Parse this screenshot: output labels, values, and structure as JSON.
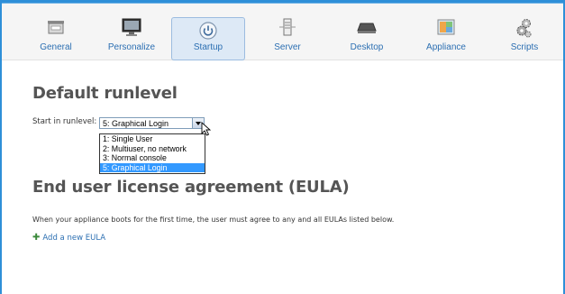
{
  "toolbar": {
    "tabs": [
      {
        "label": "General",
        "icon": "general-icon"
      },
      {
        "label": "Personalize",
        "icon": "monitor-icon"
      },
      {
        "label": "Startup",
        "icon": "power-icon",
        "active": true
      },
      {
        "label": "Server",
        "icon": "server-icon"
      },
      {
        "label": "Desktop",
        "icon": "desktop-icon"
      },
      {
        "label": "Appliance",
        "icon": "appliance-icon"
      },
      {
        "label": "Scripts",
        "icon": "gears-icon"
      }
    ]
  },
  "runlevel": {
    "heading": "Default runlevel",
    "label": "Start in runlevel:",
    "selected": "5: Graphical Login",
    "options": [
      "1: Single User",
      "2: Multiuser, no network",
      "3: Normal console",
      "5: Graphical Login"
    ]
  },
  "eula": {
    "heading": "End user license agreement (EULA)",
    "description": "When your appliance boots for the first time, the user must agree to any and all EULAs listed below.",
    "add_label": "Add a new EULA"
  },
  "colors": {
    "accent": "#2c6fb2",
    "selection": "#3399ff",
    "frame": "#2e8fd8"
  }
}
